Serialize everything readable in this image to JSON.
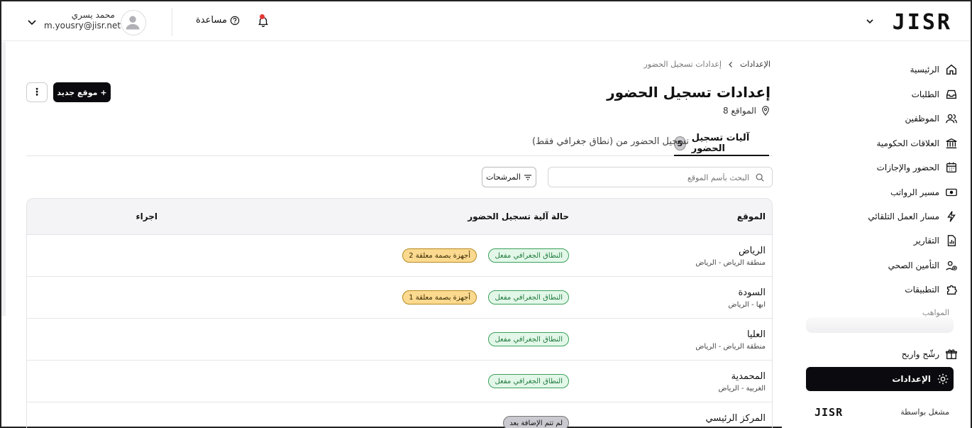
{
  "header": {
    "logo": "JISR",
    "help_label": "مساعدة",
    "user_name": "محمد يسري",
    "user_email": "m.yousry@jisr.net"
  },
  "breadcrumb": {
    "root": "الإعدادات",
    "current": "إعدادات تسجيل الحضور"
  },
  "page": {
    "title": "إعدادات تسجيل الحضور",
    "locations_count": "8 المواقع",
    "new_location_label": "موقع جديد",
    "more_label": "⋮"
  },
  "tabs": [
    {
      "label": "آليات تسجيل الحضور",
      "count": "5",
      "active": true
    },
    {
      "label": "تسجيل الحضور من (نطاق جغرافي فقط)",
      "active": false
    }
  ],
  "search": {
    "placeholder": "البحث بأسم الموقع"
  },
  "filters_label": "المرشحات",
  "table": {
    "columns": [
      "الموقع",
      "حالة آلية تسجيل الحضور",
      "اجراء"
    ],
    "rows": [
      {
        "name": "الرياض",
        "sub": "منطقة الرياض - الرياض",
        "status": "النطاق الجغرافي مفعل",
        "status_type": "green",
        "extra": "2 أجهزة بصمة معلقة"
      },
      {
        "name": "السودة",
        "sub": "ابها - الرياض",
        "status": "النطاق الجغرافي مفعل",
        "status_type": "green",
        "extra": "1 أجهزة بصمة معلقة"
      },
      {
        "name": "العليا",
        "sub": "منطقة الرياض - الرياض",
        "status": "النطاق الجغرافي مفعل",
        "status_type": "green",
        "extra": ""
      },
      {
        "name": "المحمدية",
        "sub": "الغربية - الرياض",
        "status": "النطاق الجغرافي مفعل",
        "status_type": "green",
        "extra": ""
      },
      {
        "name": "المركز الرئيسي",
        "sub": "",
        "status": "لم تتم الإضافة بعد",
        "status_type": "gray",
        "extra": ""
      }
    ]
  },
  "sidebar": {
    "items": [
      {
        "label": "الرئيسية",
        "icon": "home-icon"
      },
      {
        "label": "الطلبات",
        "icon": "inbox-icon"
      },
      {
        "label": "الموظفين",
        "icon": "users-icon"
      },
      {
        "label": "العلاقات الحكومية",
        "icon": "bank-icon"
      },
      {
        "label": "الحضور والإجازات",
        "icon": "calendar-icon"
      },
      {
        "label": "مسير الرواتب",
        "icon": "money-icon"
      },
      {
        "label": "مسار العمل التلقائي",
        "icon": "automation-icon"
      },
      {
        "label": "التقارير",
        "icon": "report-icon"
      },
      {
        "label": "التأمين الصحي",
        "icon": "health-icon"
      },
      {
        "label": "التطبيقات",
        "icon": "puzzle-icon"
      }
    ],
    "section_label": "المواهب",
    "refer_label": "رشّح واربح",
    "settings_label": "الإعدادات",
    "powered_by": "مشغل بواسطة",
    "powered_logo": "JISR"
  },
  "colors": {
    "accent": "#0b0b0f",
    "success": "#1e7b3c",
    "warning": "#fbd98f",
    "alert_dot": "#e53935"
  }
}
